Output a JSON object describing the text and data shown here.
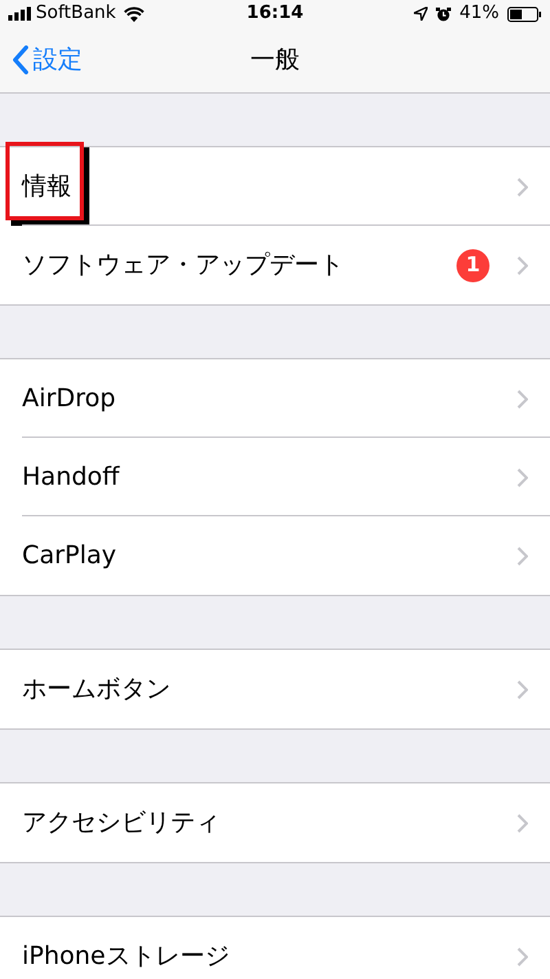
{
  "status_bar": {
    "carrier": "SoftBank",
    "time": "16:14",
    "battery": "41%"
  },
  "nav": {
    "back": "設定",
    "title": "一般"
  },
  "groups": [
    {
      "items": [
        {
          "label": "情報",
          "highlighted": true
        },
        {
          "label": "ソフトウェア・アップデート",
          "badge": "1",
          "highlighted": false
        }
      ]
    },
    {
      "items": [
        {
          "label": "AirDrop",
          "highlighted": false
        },
        {
          "label": "Handoff",
          "highlighted": false
        },
        {
          "label": "CarPlay",
          "highlighted": false
        }
      ]
    },
    {
      "items": [
        {
          "label": "ホームボタン",
          "highlighted": false
        }
      ]
    },
    {
      "items": [
        {
          "label": "アクセシビリティ",
          "highlighted": false
        }
      ]
    },
    {
      "items": [
        {
          "label": "iPhoneストレージ",
          "highlighted": false
        }
      ]
    }
  ]
}
